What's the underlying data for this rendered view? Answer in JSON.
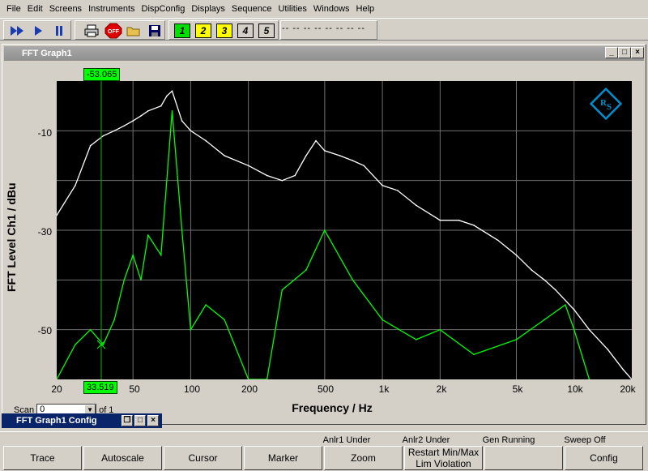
{
  "menu": [
    "File",
    "Edit",
    "Screens",
    "Instruments",
    "DispConfig",
    "Displays",
    "Sequence",
    "Utilities",
    "Windows",
    "Help"
  ],
  "toolbar": {
    "off_label": "OFF",
    "numbers": [
      "1",
      "2",
      "3",
      "4",
      "5"
    ],
    "dashes": "-- -- -- -- -- -- -- --"
  },
  "window": {
    "title": "FFT Graph1"
  },
  "graph": {
    "cursor_top": "-53.065",
    "cursor_bottom": "33.519",
    "ylabel": "FFT Level Ch1 / dBu",
    "xlabel": "Frequency / Hz",
    "yticks": [
      "-10",
      "-30",
      "-50"
    ],
    "xticks": [
      "20",
      "50",
      "100",
      "200",
      "500",
      "1k",
      "2k",
      "5k",
      "10k",
      "20k"
    ]
  },
  "chart_data": {
    "type": "line",
    "title": "",
    "xlabel": "Frequency / Hz",
    "ylabel": "FFT Level Ch1 / dBu",
    "xscale": "log",
    "xlim": [
      20,
      20000
    ],
    "ylim": [
      -60,
      0
    ],
    "grid": true,
    "series": [
      {
        "color": "#ffffff",
        "x": [
          20,
          25,
          30,
          35,
          40,
          45,
          50,
          55,
          60,
          70,
          75,
          80,
          90,
          100,
          120,
          150,
          200,
          250,
          300,
          350,
          400,
          450,
          500,
          600,
          700,
          800,
          1000,
          1200,
          1500,
          2000,
          2500,
          3000,
          4000,
          5000,
          6000,
          7000,
          8000,
          10000,
          12000,
          15000,
          18000,
          20000
        ],
        "values": [
          -27,
          -21,
          -13,
          -11,
          -10,
          -9,
          -8,
          -7,
          -6,
          -5,
          -3,
          -2,
          -8,
          -10,
          -12,
          -15,
          -17,
          -19,
          -20,
          -19,
          -15,
          -12,
          -14,
          -15,
          -16,
          -17,
          -21,
          -22,
          -25,
          -28,
          -28,
          -29,
          -32,
          -35,
          -38,
          -40,
          -42,
          -46,
          -50,
          -54,
          -58,
          -60
        ]
      },
      {
        "color": "#00ff00",
        "x": [
          20,
          25,
          30,
          35,
          40,
          45,
          50,
          55,
          60,
          70,
          75,
          80,
          90,
          100,
          120,
          150,
          200,
          250,
          300,
          400,
          500,
          700,
          1000,
          1500,
          2000,
          3000,
          5000,
          7000,
          9000,
          10000,
          12000
        ],
        "values": [
          -60,
          -53,
          -50,
          -53,
          -48,
          -40,
          -35,
          -40,
          -31,
          -35,
          -20,
          -6,
          -30,
          -50,
          -45,
          -48,
          -60,
          -60,
          -42,
          -38,
          -30,
          -40,
          -48,
          -52,
          -50,
          -55,
          -52,
          -48,
          -45,
          -50,
          -60
        ]
      }
    ]
  },
  "scan": {
    "label": "Scan",
    "value": "0",
    "of": "of 1"
  },
  "config_window": {
    "title": "FFT Graph1 Config"
  },
  "status": [
    "Anlr1 Under",
    "Anlr2 Under",
    "Gen Running",
    "Sweep Off"
  ],
  "softkeys": [
    "Trace",
    "Autoscale",
    "Cursor",
    "Marker",
    "Zoom",
    "Restart Min/Max\nLim Violation",
    "",
    "Config"
  ]
}
